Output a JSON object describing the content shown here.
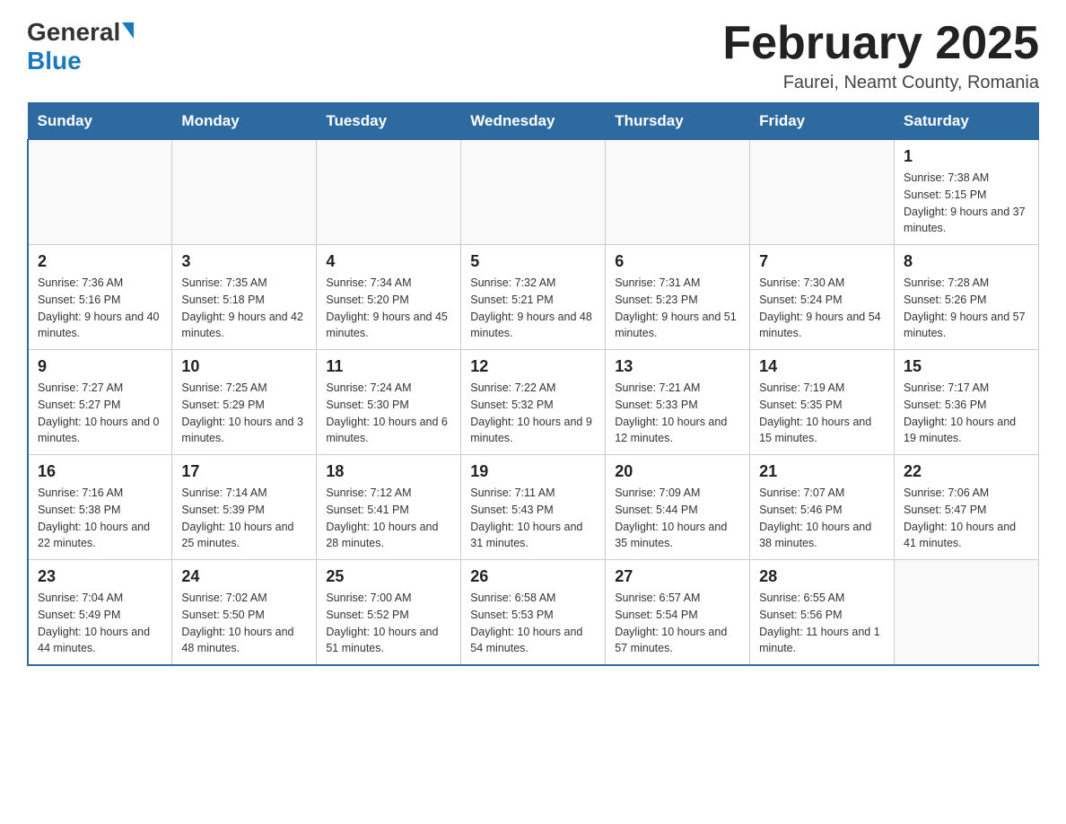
{
  "logo": {
    "general": "General",
    "blue": "Blue"
  },
  "title": "February 2025",
  "location": "Faurei, Neamt County, Romania",
  "days_of_week": [
    "Sunday",
    "Monday",
    "Tuesday",
    "Wednesday",
    "Thursday",
    "Friday",
    "Saturday"
  ],
  "weeks": [
    [
      {
        "day": "",
        "info": ""
      },
      {
        "day": "",
        "info": ""
      },
      {
        "day": "",
        "info": ""
      },
      {
        "day": "",
        "info": ""
      },
      {
        "day": "",
        "info": ""
      },
      {
        "day": "",
        "info": ""
      },
      {
        "day": "1",
        "info": "Sunrise: 7:38 AM\nSunset: 5:15 PM\nDaylight: 9 hours and 37 minutes."
      }
    ],
    [
      {
        "day": "2",
        "info": "Sunrise: 7:36 AM\nSunset: 5:16 PM\nDaylight: 9 hours and 40 minutes."
      },
      {
        "day": "3",
        "info": "Sunrise: 7:35 AM\nSunset: 5:18 PM\nDaylight: 9 hours and 42 minutes."
      },
      {
        "day": "4",
        "info": "Sunrise: 7:34 AM\nSunset: 5:20 PM\nDaylight: 9 hours and 45 minutes."
      },
      {
        "day": "5",
        "info": "Sunrise: 7:32 AM\nSunset: 5:21 PM\nDaylight: 9 hours and 48 minutes."
      },
      {
        "day": "6",
        "info": "Sunrise: 7:31 AM\nSunset: 5:23 PM\nDaylight: 9 hours and 51 minutes."
      },
      {
        "day": "7",
        "info": "Sunrise: 7:30 AM\nSunset: 5:24 PM\nDaylight: 9 hours and 54 minutes."
      },
      {
        "day": "8",
        "info": "Sunrise: 7:28 AM\nSunset: 5:26 PM\nDaylight: 9 hours and 57 minutes."
      }
    ],
    [
      {
        "day": "9",
        "info": "Sunrise: 7:27 AM\nSunset: 5:27 PM\nDaylight: 10 hours and 0 minutes."
      },
      {
        "day": "10",
        "info": "Sunrise: 7:25 AM\nSunset: 5:29 PM\nDaylight: 10 hours and 3 minutes."
      },
      {
        "day": "11",
        "info": "Sunrise: 7:24 AM\nSunset: 5:30 PM\nDaylight: 10 hours and 6 minutes."
      },
      {
        "day": "12",
        "info": "Sunrise: 7:22 AM\nSunset: 5:32 PM\nDaylight: 10 hours and 9 minutes."
      },
      {
        "day": "13",
        "info": "Sunrise: 7:21 AM\nSunset: 5:33 PM\nDaylight: 10 hours and 12 minutes."
      },
      {
        "day": "14",
        "info": "Sunrise: 7:19 AM\nSunset: 5:35 PM\nDaylight: 10 hours and 15 minutes."
      },
      {
        "day": "15",
        "info": "Sunrise: 7:17 AM\nSunset: 5:36 PM\nDaylight: 10 hours and 19 minutes."
      }
    ],
    [
      {
        "day": "16",
        "info": "Sunrise: 7:16 AM\nSunset: 5:38 PM\nDaylight: 10 hours and 22 minutes."
      },
      {
        "day": "17",
        "info": "Sunrise: 7:14 AM\nSunset: 5:39 PM\nDaylight: 10 hours and 25 minutes."
      },
      {
        "day": "18",
        "info": "Sunrise: 7:12 AM\nSunset: 5:41 PM\nDaylight: 10 hours and 28 minutes."
      },
      {
        "day": "19",
        "info": "Sunrise: 7:11 AM\nSunset: 5:43 PM\nDaylight: 10 hours and 31 minutes."
      },
      {
        "day": "20",
        "info": "Sunrise: 7:09 AM\nSunset: 5:44 PM\nDaylight: 10 hours and 35 minutes."
      },
      {
        "day": "21",
        "info": "Sunrise: 7:07 AM\nSunset: 5:46 PM\nDaylight: 10 hours and 38 minutes."
      },
      {
        "day": "22",
        "info": "Sunrise: 7:06 AM\nSunset: 5:47 PM\nDaylight: 10 hours and 41 minutes."
      }
    ],
    [
      {
        "day": "23",
        "info": "Sunrise: 7:04 AM\nSunset: 5:49 PM\nDaylight: 10 hours and 44 minutes."
      },
      {
        "day": "24",
        "info": "Sunrise: 7:02 AM\nSunset: 5:50 PM\nDaylight: 10 hours and 48 minutes."
      },
      {
        "day": "25",
        "info": "Sunrise: 7:00 AM\nSunset: 5:52 PM\nDaylight: 10 hours and 51 minutes."
      },
      {
        "day": "26",
        "info": "Sunrise: 6:58 AM\nSunset: 5:53 PM\nDaylight: 10 hours and 54 minutes."
      },
      {
        "day": "27",
        "info": "Sunrise: 6:57 AM\nSunset: 5:54 PM\nDaylight: 10 hours and 57 minutes."
      },
      {
        "day": "28",
        "info": "Sunrise: 6:55 AM\nSunset: 5:56 PM\nDaylight: 11 hours and 1 minute."
      },
      {
        "day": "",
        "info": ""
      }
    ]
  ]
}
